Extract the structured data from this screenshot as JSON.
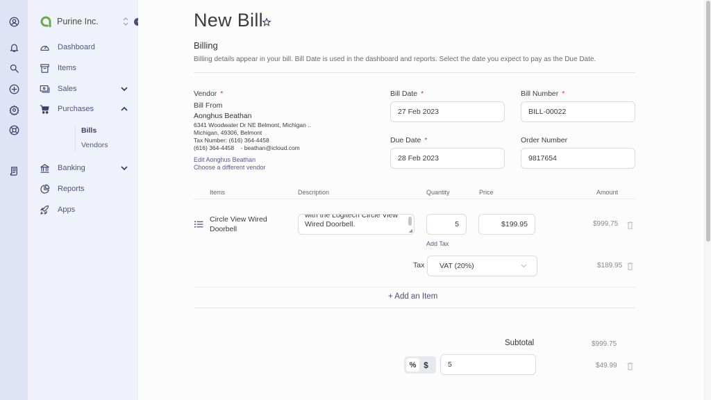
{
  "rail": {
    "icons": [
      "profile-icon",
      "bell-icon",
      "search-icon",
      "add-circle-icon",
      "gear-icon",
      "support-icon",
      "receipt-icon"
    ]
  },
  "sidebar": {
    "company_name": "Purine Inc.",
    "items": [
      {
        "label": "Dashboard",
        "icon": "dashboard-icon"
      },
      {
        "label": "Items",
        "icon": "archive-icon"
      },
      {
        "label": "Sales",
        "icon": "money-icon",
        "expanded": false
      },
      {
        "label": "Purchases",
        "icon": "cart-icon",
        "expanded": true
      },
      {
        "label": "Banking",
        "icon": "bank-icon",
        "expanded": false
      },
      {
        "label": "Reports",
        "icon": "pie-chart-icon"
      },
      {
        "label": "Apps",
        "icon": "rocket-icon"
      }
    ],
    "purchases_sub": [
      {
        "label": "Bills",
        "active": true
      },
      {
        "label": "Vendors",
        "active": false
      }
    ]
  },
  "page": {
    "title": "New Bill",
    "section_title": "Billing",
    "section_desc": "Billing details appear in your bill. Bill Date is used in the dashboard and reports. Select the date you expect to pay as the Due Date."
  },
  "vendor": {
    "label": "Vendor",
    "bill_from": "Bill From",
    "name": "Aonghus Beathan",
    "address1": "6341 Woodwater Dr NE Belmont, Michigan ..",
    "address2": "Michigan, 49306, Belmont",
    "tax_number": "Tax Number: (616) 364-4458",
    "contact": "(616) 364-4458    - beathan@icloud.com",
    "edit_link": "Edit Aonghus Beathan",
    "choose_link": "Choose a different vendor"
  },
  "fields": {
    "bill_date": {
      "label": "Bill Date",
      "value": "27 Feb 2023"
    },
    "bill_number": {
      "label": "Bill Number",
      "value": "BILL-00022"
    },
    "due_date": {
      "label": "Due Date",
      "value": "28 Feb 2023"
    },
    "order_number": {
      "label": "Order Number",
      "value": "9817654"
    }
  },
  "items_table": {
    "headers": {
      "items": "Items",
      "description": "Description",
      "quantity": "Quantity",
      "price": "Price",
      "amount": "Amount"
    },
    "rows": [
      {
        "name": "Circle View Wired Doorbell",
        "description": "with the Logitech Circle View Wired Doorbell.",
        "quantity": "5",
        "price": "$199.95",
        "amount": "$999.75",
        "add_tax": "Add Tax",
        "tax_label": "Tax",
        "tax_value": "VAT (20%)",
        "tax_amount": "$189.95"
      }
    ],
    "add_item": "+ Add an Item"
  },
  "totals": {
    "subtotal_label": "Subtotal",
    "subtotal_value": "$999.75",
    "discount_mode_percent": "%",
    "discount_mode_dollar": "$",
    "discount_value": "5",
    "discount_amount": "$49.99"
  },
  "colors": {
    "accent": "#4a4d85",
    "required": "#e0353d",
    "logo": "#6aa84f",
    "rail_bg": "#dfe3f6",
    "sidebar_bg": "#eff2fb"
  }
}
